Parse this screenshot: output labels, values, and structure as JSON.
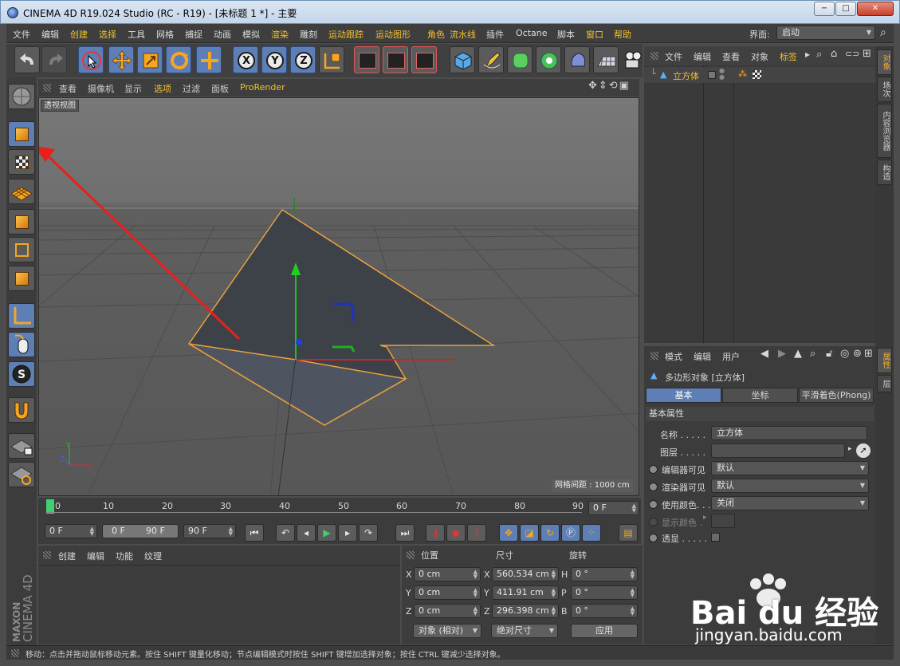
{
  "window": {
    "title": "CINEMA 4D R19.024 Studio (RC - R19) - [未标题 1 *] - 主要",
    "minimize": "−",
    "maximize": "□",
    "close": "✕"
  },
  "menu": {
    "items": [
      "文件",
      "编辑",
      "创建",
      "选择",
      "工具",
      "网格",
      "捕捉",
      "动画",
      "模拟",
      "渲染",
      "雕刻",
      "运动跟踪",
      "运动图形",
      "角色",
      "流水线",
      "插件",
      "Octane",
      "脚本",
      "窗口",
      "帮助"
    ],
    "layout_label": "界面:",
    "layout_value": "启动"
  },
  "toolbar": {
    "xyz": [
      "X",
      "Y",
      "Z"
    ]
  },
  "viewport": {
    "menu": [
      "查看",
      "摄像机",
      "显示",
      "选项",
      "过滤",
      "面板",
      "ProRender"
    ],
    "label": "透视视图",
    "grid_info": "网格间距 : 1000 cm",
    "axes": {
      "x": "X",
      "y": "Y",
      "z": "Z"
    }
  },
  "timeline": {
    "ticks": [
      "0",
      "10",
      "20",
      "30",
      "40",
      "50",
      "60",
      "70",
      "80",
      "90"
    ],
    "end_field": "0 F",
    "start": "0 F",
    "range_start": "0 F",
    "range_end": "90 F",
    "end": "90 F"
  },
  "materials": {
    "menu": [
      "创建",
      "编辑",
      "功能",
      "纹理"
    ]
  },
  "brand": {
    "line1": "MAXON",
    "line2": "CINEMA 4D"
  },
  "coords": {
    "headers": [
      "位置",
      "尺寸",
      "旋转"
    ],
    "rows": [
      {
        "a": "X",
        "pos": "0 cm",
        "b": "X",
        "size": "560.534 cm",
        "c": "H",
        "rot": "0 °"
      },
      {
        "a": "Y",
        "pos": "0 cm",
        "b": "Y",
        "size": "411.91 cm",
        "c": "P",
        "rot": "0 °"
      },
      {
        "a": "Z",
        "pos": "0 cm",
        "b": "Z",
        "size": "296.398 cm",
        "c": "B",
        "rot": "0 °"
      }
    ],
    "mode1": "对象 (相对)",
    "mode2": "绝对尺寸",
    "apply": "应用"
  },
  "objects": {
    "menu": [
      "文件",
      "编辑",
      "查看",
      "对象",
      "标签"
    ],
    "item": "立方体"
  },
  "attributes": {
    "menu": [
      "模式",
      "编辑",
      "用户"
    ],
    "object_title": "多边形对象 [立方体]",
    "tabs": [
      "基本",
      "坐标",
      "平滑着色(Phong)"
    ],
    "section": "基本属性",
    "fields": [
      {
        "label": "名称 . . . . .",
        "value": "立方体"
      },
      {
        "label": "图层 . . . . .",
        "value": ""
      },
      {
        "label": "编辑器可见",
        "value": "默认"
      },
      {
        "label": "渲染器可见",
        "value": "默认"
      },
      {
        "label": "使用颜色. . .",
        "value": "关闭"
      },
      {
        "label": "显示颜色 .",
        "value": ""
      },
      {
        "label": "透显 . . . . .",
        "value": ""
      }
    ]
  },
  "sidetabs": [
    "对象",
    "场次",
    "内容浏览器",
    "构造",
    "属性",
    "层"
  ],
  "status": "移动：点击并拖动鼠标移动元素。按住 SHIFT 键量化移动；节点编辑模式时按住 SHIFT 键增加选择对象；按住 CTRL 键减少选择对象。",
  "watermark": {
    "logo": "Bai du 经验",
    "url": "jingyan.baidu.com"
  }
}
